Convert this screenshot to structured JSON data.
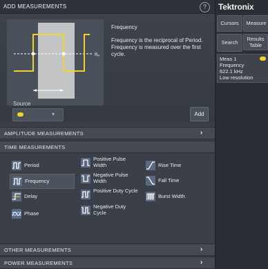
{
  "panel": {
    "title": "ADD MEASUREMENTS",
    "help_icon": "?"
  },
  "info": {
    "title": "Frequency",
    "description": "Frequency is the reciprocal of Period. Frequency is measured over the first cycle.",
    "diagram_label": "Rₐ"
  },
  "source": {
    "label": "Source",
    "dropdown_arrow": "▾",
    "chip_color": "#f3d230"
  },
  "add_label": "Add",
  "sections": {
    "amplitude": "AMPLITUDE MEASUREMENTS",
    "time": "TIME MEASUREMENTS",
    "other": "OTHER MEASUREMENTS",
    "power": "POWER MEASUREMENTS",
    "chevron": "›"
  },
  "time_measurements": [
    {
      "label": "Period",
      "icon": "period-icon"
    },
    {
      "label": "Frequency",
      "icon": "frequency-icon",
      "selected": true
    },
    {
      "label": "Delay",
      "icon": "delay-icon"
    },
    {
      "label": "Phase",
      "icon": "phase-icon"
    },
    {
      "label": "Positive Pulse Width",
      "icon": "positive-pulse-width-icon"
    },
    {
      "label": "Negative Pulse Width",
      "icon": "negative-pulse-width-icon"
    },
    {
      "label": "Positive Duty Cycle",
      "icon": "positive-duty-cycle-icon"
    },
    {
      "label": "Negative Duty Cycle",
      "icon": "negative-duty-cycle-icon"
    },
    {
      "label": "Rise Time",
      "icon": "rise-time-icon"
    },
    {
      "label": "Fall Time",
      "icon": "fall-time-icon"
    },
    {
      "label": "Burst Width",
      "icon": "burst-width-icon"
    }
  ],
  "right": {
    "brand": "Tektronix",
    "buttons": {
      "cursors": "Cursors",
      "measure": "Measure",
      "search": "Search",
      "results_table": "Results Table"
    },
    "meas_badge": {
      "name": "Meas 1",
      "type": "Frequency",
      "value": "622.1 kHz",
      "note": "Low resolution",
      "dot_color": "#f3d230"
    }
  },
  "colors": {
    "accent": "#f3d230",
    "panel_bg": "#3a3f47",
    "section_bg": "#454a52"
  }
}
